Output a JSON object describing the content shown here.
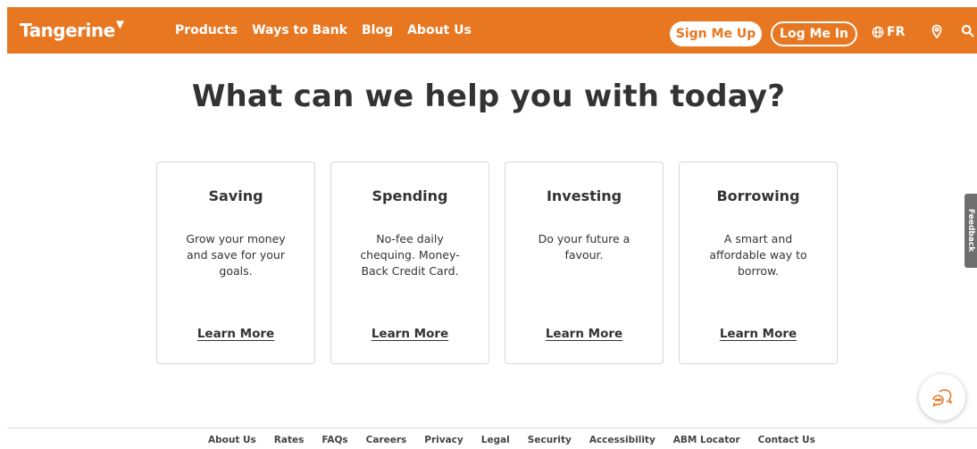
{
  "colors": {
    "brand": "#e87722",
    "text": "#333333",
    "card_border": "#d8d8d8",
    "feedback_bg": "#6f6f6f"
  },
  "header": {
    "logo": "Tangerine",
    "nav": [
      "Products",
      "Ways to Bank",
      "Blog",
      "About Us"
    ],
    "sign_up": "Sign Me Up",
    "log_in": "Log Me In",
    "language": "FR",
    "icons": [
      "globe-icon",
      "location-pin-icon",
      "search-icon"
    ]
  },
  "main": {
    "headline": "What can we help you with today?",
    "cards": [
      {
        "title": "Saving",
        "description": "Grow your money and save for your goals.",
        "link": "Learn More"
      },
      {
        "title": "Spending",
        "description": "No-fee daily chequing. Money-Back Credit Card.",
        "link": "Learn More"
      },
      {
        "title": "Investing",
        "description": "Do your future a favour.",
        "link": "Learn More"
      },
      {
        "title": "Borrowing",
        "description": "A smart and affordable way to borrow.",
        "link": "Learn More"
      }
    ]
  },
  "feedback": {
    "label": "Feedback"
  },
  "chat": {
    "icon": "chat-bubble-icon"
  },
  "footer": {
    "links": [
      "About Us",
      "Rates",
      "FAQs",
      "Careers",
      "Privacy",
      "Legal",
      "Security",
      "Accessibility",
      "ABM Locator",
      "Contact Us"
    ]
  }
}
